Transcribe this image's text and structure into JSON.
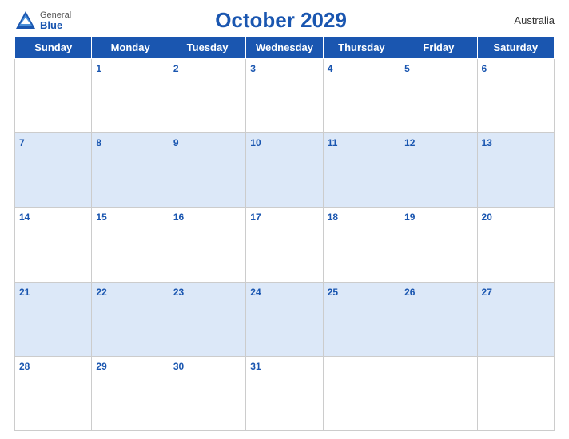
{
  "header": {
    "logo_general": "General",
    "logo_blue": "Blue",
    "title": "October 2029",
    "country": "Australia"
  },
  "days_of_week": [
    "Sunday",
    "Monday",
    "Tuesday",
    "Wednesday",
    "Thursday",
    "Friday",
    "Saturday"
  ],
  "weeks": [
    [
      {
        "day": "",
        "blue": false
      },
      {
        "day": "1",
        "blue": false
      },
      {
        "day": "2",
        "blue": false
      },
      {
        "day": "3",
        "blue": false
      },
      {
        "day": "4",
        "blue": false
      },
      {
        "day": "5",
        "blue": false
      },
      {
        "day": "6",
        "blue": false
      }
    ],
    [
      {
        "day": "7",
        "blue": true
      },
      {
        "day": "8",
        "blue": true
      },
      {
        "day": "9",
        "blue": true
      },
      {
        "day": "10",
        "blue": true
      },
      {
        "day": "11",
        "blue": true
      },
      {
        "day": "12",
        "blue": true
      },
      {
        "day": "13",
        "blue": true
      }
    ],
    [
      {
        "day": "14",
        "blue": false
      },
      {
        "day": "15",
        "blue": false
      },
      {
        "day": "16",
        "blue": false
      },
      {
        "day": "17",
        "blue": false
      },
      {
        "day": "18",
        "blue": false
      },
      {
        "day": "19",
        "blue": false
      },
      {
        "day": "20",
        "blue": false
      }
    ],
    [
      {
        "day": "21",
        "blue": true
      },
      {
        "day": "22",
        "blue": true
      },
      {
        "day": "23",
        "blue": true
      },
      {
        "day": "24",
        "blue": true
      },
      {
        "day": "25",
        "blue": true
      },
      {
        "day": "26",
        "blue": true
      },
      {
        "day": "27",
        "blue": true
      }
    ],
    [
      {
        "day": "28",
        "blue": false
      },
      {
        "day": "29",
        "blue": false
      },
      {
        "day": "30",
        "blue": false
      },
      {
        "day": "31",
        "blue": false
      },
      {
        "day": "",
        "blue": false
      },
      {
        "day": "",
        "blue": false
      },
      {
        "day": "",
        "blue": false
      }
    ]
  ]
}
